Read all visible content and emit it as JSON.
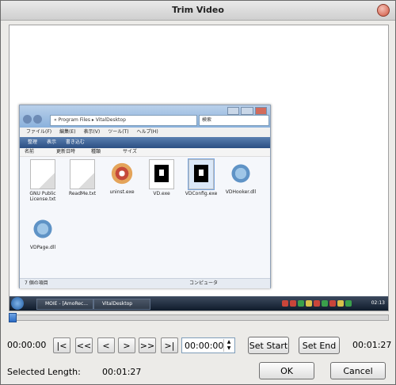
{
  "window": {
    "title": "Trim Video"
  },
  "preview": {
    "explorer": {
      "address": "« Program Files ▸ VitalDesktop",
      "search_placeholder": "検索",
      "menu": [
        "ファイル(F)",
        "編集(E)",
        "表示(V)",
        "ツール(T)",
        "ヘルプ(H)"
      ],
      "toolbar": [
        "整理",
        "表示",
        "書き込む"
      ],
      "columns": [
        "名前",
        "更新日時",
        "種類",
        "サイズ"
      ],
      "files": [
        {
          "name": "GNU Public License.txt",
          "icon": "text-document-icon"
        },
        {
          "name": "ReadMe.txt",
          "icon": "text-document-icon"
        },
        {
          "name": "uninst.exe",
          "icon": "installer-disc-icon"
        },
        {
          "name": "VD.exe",
          "icon": "vitaldesktop-app-icon"
        },
        {
          "name": "VDConfig.exe",
          "icon": "vitaldesktop-app-icon"
        },
        {
          "name": "VDHooker.dll",
          "icon": "gear-dll-icon"
        },
        {
          "name": "VDPage.dll",
          "icon": "gear-dll-icon"
        }
      ],
      "status_left": "7 個の項目",
      "status_right": "コンピュータ"
    },
    "taskbar": {
      "tasks": [
        "MOIE - [AmoRec...",
        "VitalDesktop"
      ],
      "clock": "02:13"
    }
  },
  "controls": {
    "time_left": "00:00:00",
    "time_right": "00:01:27",
    "position": 0,
    "nav": {
      "first": "|<",
      "prev_big": "<<",
      "prev": "<",
      "next": ">",
      "next_big": ">>",
      "last": ">|"
    },
    "time_field": "00:00:00",
    "set_start": "Set Start",
    "set_end": "Set End",
    "selected_length_label": "Selected Length:",
    "selected_length_value": "00:01:27",
    "ok": "OK",
    "cancel": "Cancel"
  }
}
